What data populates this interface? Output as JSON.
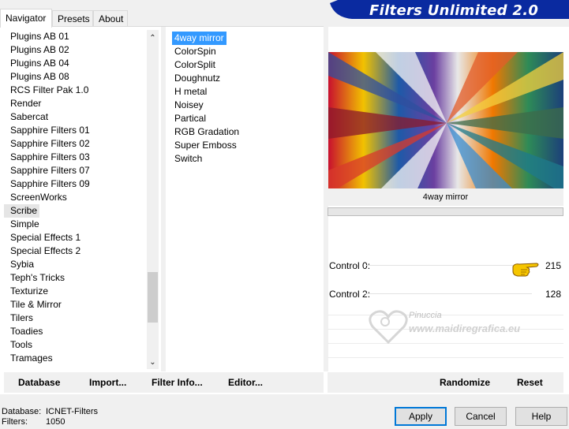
{
  "tabs": [
    "Navigator",
    "Presets",
    "About"
  ],
  "banner": {
    "title": "Filters Unlimited 2.0"
  },
  "categories": [
    "Plugins AB 01",
    "Plugins AB 02",
    "Plugins AB 04",
    "Plugins AB 08",
    "RCS Filter Pak 1.0",
    "Render",
    "Sabercat",
    "Sapphire Filters 01",
    "Sapphire Filters 02",
    "Sapphire Filters 03",
    "Sapphire Filters 07",
    "Sapphire Filters 09",
    "ScreenWorks",
    "Scribe",
    "Simple",
    "Special Effects 1",
    "Special Effects 2",
    "Sybia",
    "Teph's Tricks",
    "Texturize",
    "Tile & Mirror",
    "Tilers",
    "Toadies",
    "Tools",
    "Tramages"
  ],
  "filters": [
    "4way mirror",
    "ColorSpin",
    "ColorSplit",
    "Doughnutz",
    "H metal",
    "Noisey",
    "Partical",
    "RGB Gradation",
    "Super Emboss",
    "Switch"
  ],
  "selected_filter": "4way mirror",
  "controls": [
    {
      "label": "Control 0:",
      "value": "215"
    },
    {
      "label": "Control 2:",
      "value": "128"
    }
  ],
  "left_buttons": {
    "database": "Database",
    "import": "Import...",
    "filter_info": "Filter Info...",
    "editor": "Editor..."
  },
  "right_buttons": {
    "randomize": "Randomize",
    "reset": "Reset"
  },
  "footer": {
    "database_label": "Database:",
    "database_value": "ICNET-Filters",
    "filters_label": "Filters:",
    "filters_value": "1050"
  },
  "dialog_buttons": {
    "apply": "Apply",
    "cancel": "Cancel",
    "help": "Help"
  },
  "watermark": {
    "name": "Pinuccia",
    "url": "www.maidiregrafica.eu"
  },
  "colors": {
    "banner": "#0a2aa0",
    "selection": "#3399ff",
    "focus": "#0078d7"
  }
}
